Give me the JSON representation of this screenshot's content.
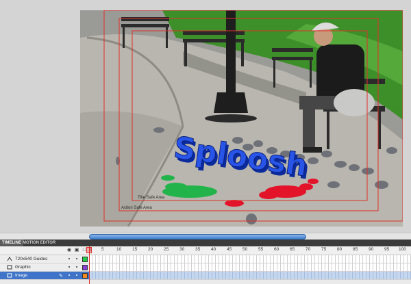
{
  "stage": {
    "title_safe_label": "Title Safe Area",
    "action_safe_label": "Action Safe Area",
    "graphic_text": "Sploosh"
  },
  "panels": {
    "timeline_tab": "TIMELINE",
    "motion_editor_tab": "MOTION EDITOR"
  },
  "timeline": {
    "header_icons": [
      "eye-icon",
      "lock-icon",
      "outline-icon"
    ],
    "ruler_ticks": [
      "1",
      "5",
      "10",
      "15",
      "20",
      "25",
      "30",
      "35",
      "40",
      "45",
      "50",
      "55",
      "60",
      "65",
      "70",
      "75",
      "80",
      "85",
      "90",
      "95",
      "100"
    ],
    "layers": [
      {
        "name": "720x540 Guides",
        "type": "guide",
        "color": "#22cc44"
      },
      {
        "name": "Graphic",
        "type": "layer",
        "color": "#8a3fd6"
      },
      {
        "name": "Image",
        "type": "layer",
        "color": "#f08a1e",
        "selected": true
      }
    ]
  },
  "colors": {
    "accent": "#3f74c8",
    "playhead": "#e0302a",
    "guide": "#e0302a"
  }
}
